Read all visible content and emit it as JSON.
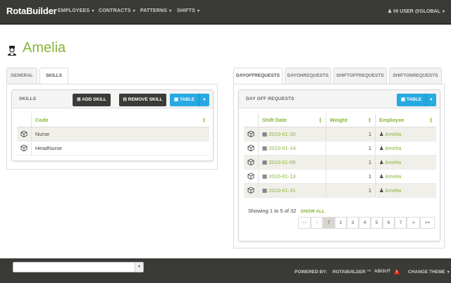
{
  "navbar": {
    "brand": "RotaBuilder",
    "items": [
      {
        "label": "EMPLOYEES"
      },
      {
        "label": "CONTRACTS"
      },
      {
        "label": "PATTERNS"
      },
      {
        "label": "SHIFTS"
      }
    ],
    "user": "HI USER @GLOBAL"
  },
  "page": {
    "title": "Amelia"
  },
  "left": {
    "tabs": [
      {
        "label": "GENERAL"
      },
      {
        "label": "SKILLS"
      }
    ],
    "active_tab": "SKILLS",
    "panel_label": "SKILLS",
    "add_skill": "ADD SKILL",
    "remove_skill": "REMOVE SKILL",
    "table_button": "TABLE",
    "columns": [
      "Code"
    ],
    "rows": [
      {
        "code": "Nurse"
      },
      {
        "code": "HeadNurse"
      }
    ]
  },
  "right": {
    "tabs": [
      {
        "label": "DAYOFFREQUESTS"
      },
      {
        "label": "DAYONREQUESTS"
      },
      {
        "label": "SHIFTOFFREQUESTS"
      },
      {
        "label": "SHIFTONREQUESTS"
      }
    ],
    "active_tab": "DAYOFFREQUESTS",
    "panel_label": "DAY OFF REQUESTS",
    "table_button": "TABLE",
    "columns": [
      "Shift Date",
      "Weight",
      "Employee"
    ],
    "rows": [
      {
        "date": "2010-01-20",
        "weight": "1",
        "employee": "Amelia"
      },
      {
        "date": "2010-01-14",
        "weight": "1",
        "employee": "Amelia"
      },
      {
        "date": "2010-01-05",
        "weight": "1",
        "employee": "Amelia"
      },
      {
        "date": "2010-01-13",
        "weight": "1",
        "employee": "Amelia"
      },
      {
        "date": "2010-01-31",
        "weight": "1",
        "employee": "Amelia"
      }
    ],
    "showing": "Showing 1 to 5 of 32",
    "show_all": "SHOW ALL",
    "pagination": [
      "<<",
      "<",
      "7",
      "2",
      "3",
      "4",
      "5",
      "6",
      "7",
      ">",
      ">>"
    ],
    "active_page_index": 2
  },
  "footer": {
    "powered_by_label": "POWERED BY:",
    "powered_by_value": "ROTABUILDER ™",
    "about": "ABOUT",
    "change_theme": "CHANGE THEME"
  },
  "colors": {
    "accent": "#86b43a",
    "navbar": "#3a3a36",
    "button_blue": "#27a9e1",
    "warning": "#e2231a"
  }
}
